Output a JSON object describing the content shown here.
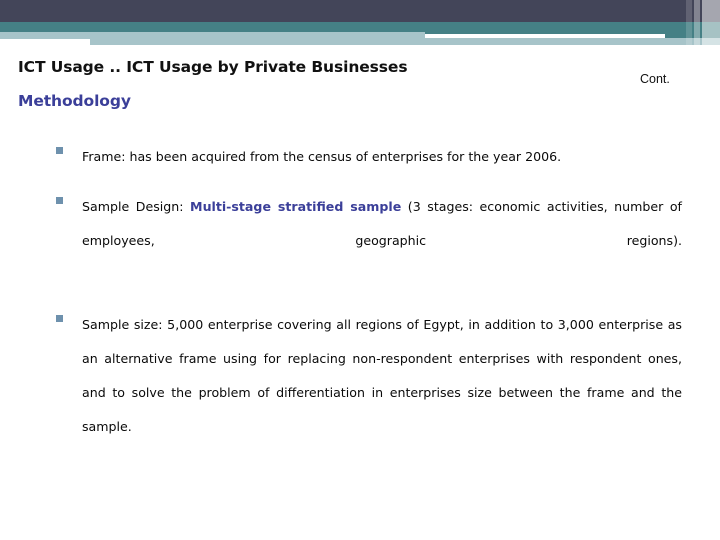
{
  "banner": {
    "colors": {
      "dark_slate": "#434559",
      "teal": "#458085",
      "light_blue": "#a7c4c9",
      "white": "#ffffff"
    }
  },
  "header": {
    "title": "ICT Usage  .. ICT Usage by Private Businesses",
    "subtitle": "Methodology",
    "continuation_label": "Cont.",
    "title_color": "#111111",
    "subtitle_color": "#3b3f99"
  },
  "content": {
    "bullet_marker_color": "#6e91ad",
    "bullets": [
      {
        "id": "frame",
        "parts": [
          {
            "text": "Frame: has been acquired from the census of enterprises for the year 2006.",
            "emphasis": false
          }
        ]
      },
      {
        "id": "sample-design",
        "parts": [
          {
            "text": "Sample Design: ",
            "emphasis": false
          },
          {
            "text": "Multi-stage stratified sample",
            "emphasis": true
          },
          {
            "text": " (3 stages: economic activities, number of employees, geographic regions).",
            "emphasis": false
          }
        ]
      },
      {
        "id": "sample-size",
        "parts": [
          {
            "text": "Sample size: 5,000 enterprise covering all regions of Egypt, in addition to 3,000 enterprise as an alternative frame using for replacing non-respondent enterprises with respondent ones, and to solve the problem of differentiation in enterprises size between the frame and the sample.",
            "emphasis": false
          }
        ]
      }
    ]
  }
}
